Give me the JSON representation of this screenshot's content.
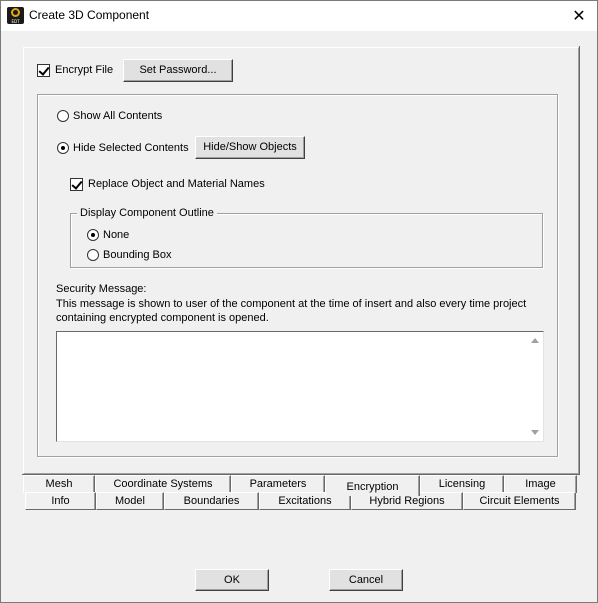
{
  "window": {
    "title": "Create 3D Component",
    "app_icon_text": "EDT",
    "close_glyph": "✕"
  },
  "encrypt": {
    "encrypt_file_label": "Encrypt File",
    "encrypt_file_checked": true,
    "set_password_label": "Set Password..."
  },
  "contents": {
    "show_all_label": "Show All Contents",
    "hide_selected_label": "Hide Selected Contents",
    "selected": "hide_selected",
    "hide_show_objects_label": "Hide/Show Objects",
    "replace_names_label": "Replace Object and Material Names",
    "replace_names_checked": true
  },
  "outline": {
    "group_title": "Display Component Outline",
    "none_label": "None",
    "bounding_box_label": "Bounding Box",
    "selected": "none"
  },
  "security": {
    "title": "Security Message:",
    "description_line1": "This message is shown to user of the component at the time of insert and also every time project",
    "description_line2": "containing encrypted component is opened.",
    "message_value": ""
  },
  "tabs": {
    "row1": [
      {
        "label": "Mesh"
      },
      {
        "label": "Coordinate Systems"
      },
      {
        "label": "Parameters"
      },
      {
        "label": "Encryption"
      },
      {
        "label": "Licensing"
      },
      {
        "label": "Image"
      }
    ],
    "row2": [
      {
        "label": "Info"
      },
      {
        "label": "Model"
      },
      {
        "label": "Boundaries"
      },
      {
        "label": "Excitations"
      },
      {
        "label": "Hybrid Regions"
      },
      {
        "label": "Circuit Elements"
      }
    ],
    "active": "Encryption"
  },
  "footer": {
    "ok_label": "OK",
    "cancel_label": "Cancel"
  }
}
